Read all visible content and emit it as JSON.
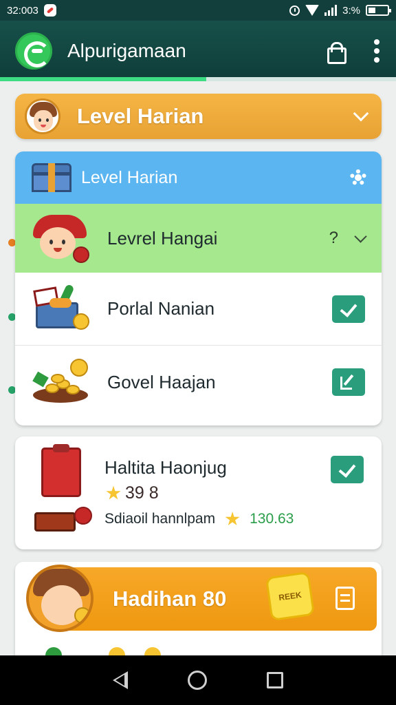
{
  "status_bar": {
    "time": "32:003",
    "battery": "3:%"
  },
  "app_bar": {
    "title": "Alpurigamaan"
  },
  "progress": {
    "value": 0.52
  },
  "banner": {
    "title": "Level Harian"
  },
  "list": {
    "header_title": "Level Harian",
    "items": [
      {
        "label": "Levrel Hangai",
        "help": "?"
      },
      {
        "label": "Porlal Nanian"
      },
      {
        "label": "Govel Haajan"
      }
    ]
  },
  "reward": {
    "title": "Haltita Haonjug",
    "score": "39 8",
    "footer_label": "Sdiaoil hannlpam",
    "footer_value": "130.63"
  },
  "bonus": {
    "title": "Hadihan 80",
    "ticket_label": "REEK"
  },
  "colors": {
    "app_bar": "#17504a",
    "accent_green": "#2a9d7c",
    "banner_orange": "#f5b545",
    "header_blue": "#5bb5f0",
    "active_row": "#a5e88e"
  },
  "icons": {
    "app_logo": "app-logo-icon",
    "shopping": "bag-icon",
    "overflow": "more-vert-icon",
    "settings": "gear-icon",
    "confirm": "check-icon",
    "edit": "edit-icon"
  }
}
